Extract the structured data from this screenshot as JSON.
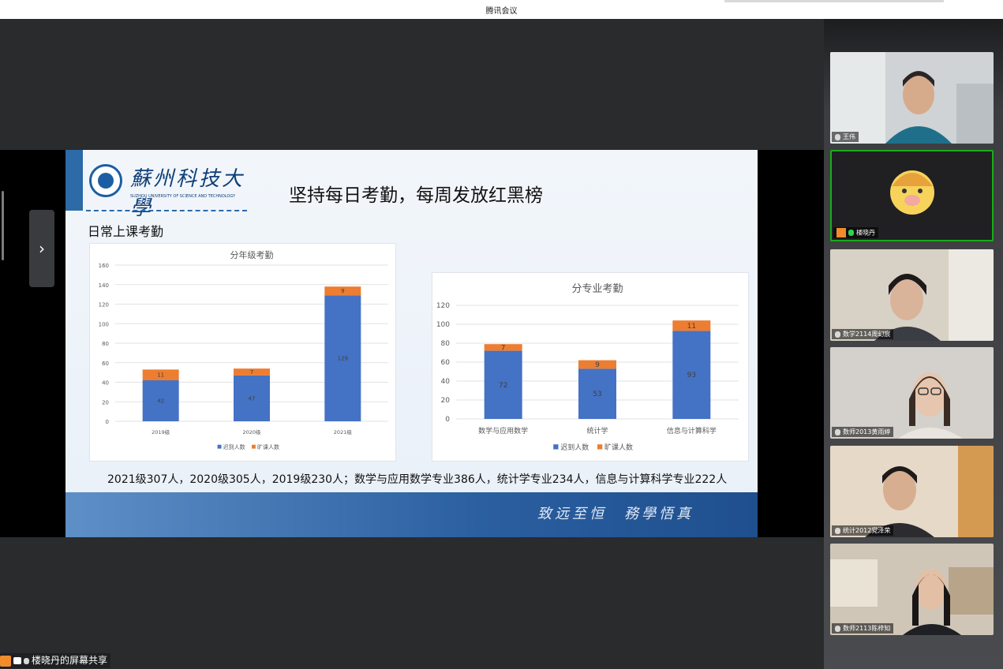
{
  "app": {
    "title": "腾讯会议"
  },
  "share": {
    "label": "楼晓丹的屏幕共享"
  },
  "slide": {
    "logo_cn": "蘇州科技大學",
    "logo_en": "SUZHOU UNIVERSITY OF SCIENCE AND TECHNOLOGY",
    "title": "坚持每日考勤，每周发放红黑榜",
    "section": "日常上课考勤",
    "summary": "2021级307人，2020级305人，2019级230人；数学与应用数学专业386人，统计学专业234人，信息与计算科学专业222人",
    "motto": "致远至恒　務學悟真"
  },
  "participants": [
    {
      "name": "王伟",
      "mic": "muted"
    },
    {
      "name": "楼晓丹",
      "mic": "on",
      "active": true
    },
    {
      "name": "数学2114周幻宸",
      "mic": "muted"
    },
    {
      "name": "数师2013黄雨婷",
      "mic": "muted"
    },
    {
      "name": "统计2012党泽荣",
      "mic": "muted"
    },
    {
      "name": "数师2113陈梓知",
      "mic": "muted"
    }
  ],
  "colors": {
    "blue": "#4472c4",
    "orange": "#ed7d31",
    "active_border": "#1aad19"
  },
  "chart_data": [
    {
      "type": "bar",
      "stacked": true,
      "title": "分年级考勤",
      "categories": [
        "2019级",
        "2020级",
        "2021级"
      ],
      "series": [
        {
          "name": "迟到人数",
          "values": [
            42,
            47,
            129
          ]
        },
        {
          "name": "旷课人数",
          "values": [
            11,
            7,
            9
          ]
        }
      ],
      "ylim": [
        0,
        160
      ],
      "yticks": [
        0,
        20,
        40,
        60,
        80,
        100,
        120,
        140,
        160
      ],
      "grid": true,
      "legend": "bottom"
    },
    {
      "type": "bar",
      "stacked": true,
      "title": "分专业考勤",
      "categories": [
        "数学与应用数学",
        "统计学",
        "信息与计算科学"
      ],
      "series": [
        {
          "name": "迟到人数",
          "values": [
            72,
            53,
            93
          ]
        },
        {
          "name": "旷课人数",
          "values": [
            7,
            9,
            11
          ]
        }
      ],
      "ylim": [
        0,
        120
      ],
      "yticks": [
        0,
        20,
        40,
        60,
        80,
        100,
        120
      ],
      "grid": true,
      "legend": "bottom"
    }
  ]
}
